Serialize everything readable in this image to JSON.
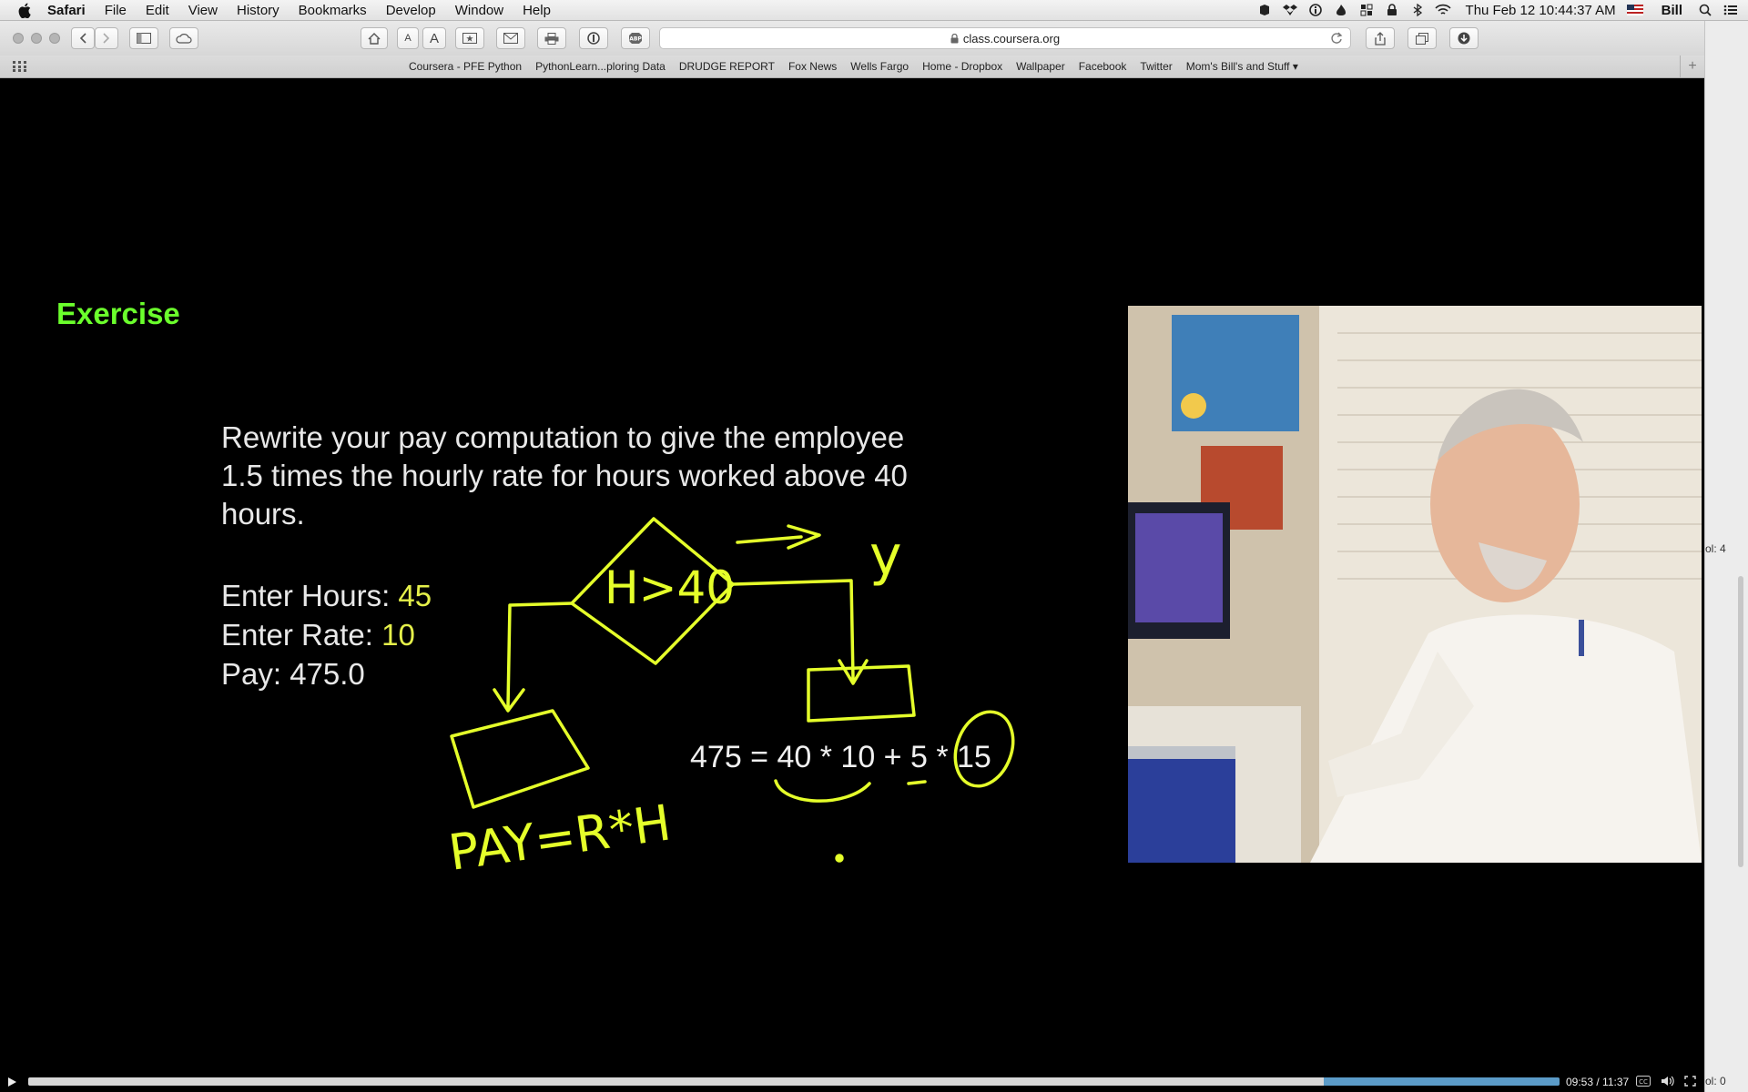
{
  "menubar": {
    "app_name": "Safari",
    "items": [
      "File",
      "Edit",
      "View",
      "History",
      "Bookmarks",
      "Develop",
      "Window",
      "Help"
    ],
    "clock": "Thu Feb 12  10:44:37 AM",
    "user": "Bill",
    "status_icons": [
      "evernote-icon",
      "dropbox-icon",
      "info-icon",
      "flame-icon",
      "grid-icon",
      "lock-icon",
      "bluetooth-icon",
      "wifi-icon",
      "flag-icon"
    ]
  },
  "toolbar": {
    "url": "class.coursera.org",
    "font_small": "A",
    "font_large": "A"
  },
  "bookmarks": {
    "items": [
      "Coursera - PFE Python",
      "PythonLearn...ploring Data",
      "DRUDGE REPORT",
      "Fox News",
      "Wells Fargo",
      "Home - Dropbox",
      "Wallpaper",
      "Facebook",
      "Twitter",
      "Mom's Bill's and Stuff"
    ]
  },
  "slide": {
    "title": "Exercise",
    "prompt_lines": [
      "Rewrite your pay computation to give the employee",
      "1.5 times the hourly rate for hours worked above 40",
      "hours."
    ],
    "hours_label": "Enter Hours: ",
    "hours_value": "45",
    "rate_label": "Enter Rate: ",
    "rate_value": "10",
    "pay_line": "Pay: 475.0",
    "equation": "475 = 40 * 10 + 5 * 15",
    "handwriting": {
      "decision": "H>40",
      "yes": "y",
      "pay": "PAY=R*H"
    }
  },
  "sidebar_labels": {
    "top": "ol: 4",
    "bottom": "ol: 0"
  },
  "player": {
    "time": "09:53 / 11:37",
    "progress": 0.846,
    "buffered": 0.84
  },
  "colors": {
    "slide_title": "#6bff2c",
    "highlight": "#e5f04a",
    "ink": "#e5ff2a",
    "progress_buffer": "#5b9bc8"
  }
}
